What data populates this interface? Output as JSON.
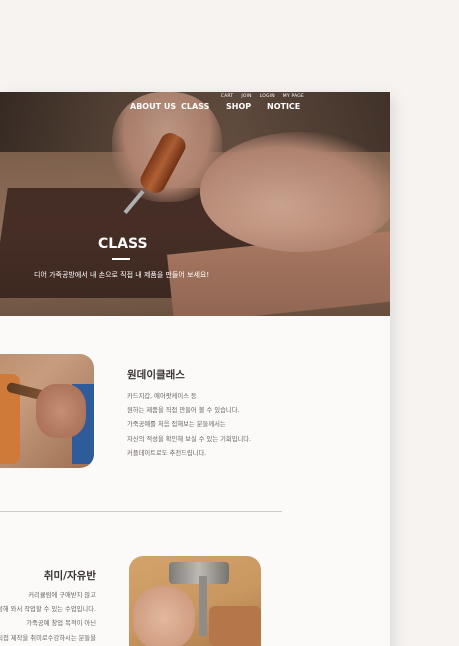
{
  "top_links": [
    "CART",
    "JOIN",
    "LOGIN",
    "MY PAGE"
  ],
  "main_nav": [
    "ABOUT US",
    "CLASS",
    "SHOP",
    "NOTICE"
  ],
  "hero": {
    "title": "CLASS",
    "subtitle": "디어 가죽공방에서 내 손으로 직접 내 제품을 만들어 보세요!"
  },
  "sections": [
    {
      "title": "원데이클래스",
      "lines": [
        "카드지갑, 에어팟케이스 등",
        "원하는 제품을 직접 만들어 볼 수 있습니다.",
        "가죽공예를 처음 접해보는 분들께서는",
        "자신의 적성을 확인해 보실 수 있는 기회입니다.",
        "커플데이트로도 추천드립니다."
      ]
    },
    {
      "title": "취미/자유반",
      "lines": [
        "커리큘럼에 구애받지 않고",
        "원하는 제품을 정해 와서 작업할 수 있는 수업입니다.",
        "가죽공예 창업 목적이 아닌",
        "취미로 가죽제품을 직접 제작을 취미로수강하시는 분들을"
      ]
    }
  ],
  "colors": {
    "background": "#f6f3f1",
    "card": "#fbfaf9",
    "heading": "#3b3532",
    "text": "#6b625e"
  }
}
